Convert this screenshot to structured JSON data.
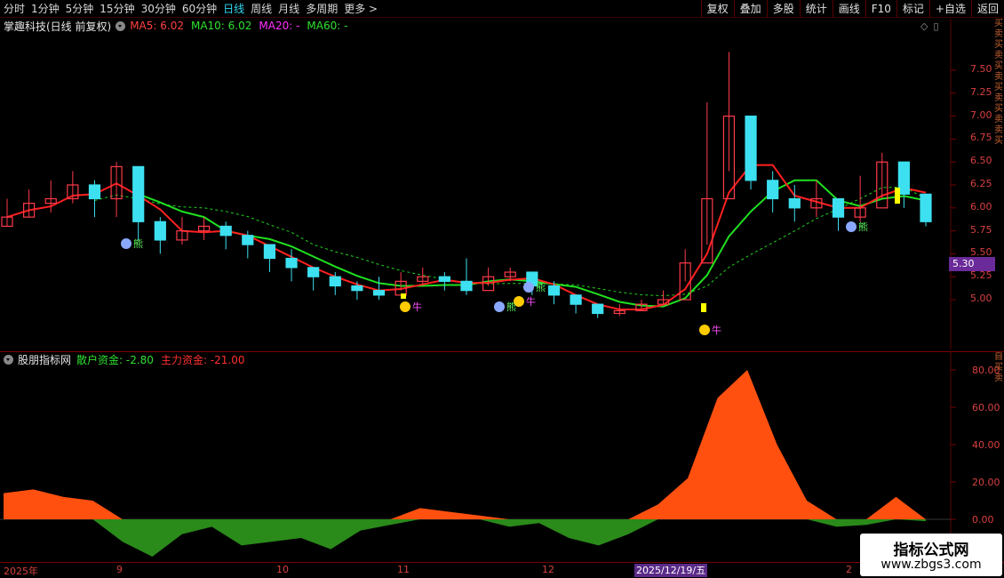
{
  "toolbar": {
    "left_tabs": [
      "分时",
      "1分钟",
      "5分钟",
      "15分钟",
      "30分钟",
      "60分钟",
      "日线",
      "周线",
      "月线",
      "多周期",
      "更多"
    ],
    "active_tab": "日线",
    "more_arrow": ">",
    "right_buttons": [
      "复权",
      "叠加",
      "多股",
      "统计",
      "画线",
      "F10",
      "标记",
      "+自选",
      "返回"
    ]
  },
  "price_panel": {
    "stock_name": "掌趣科技(日线 前复权)",
    "ma_labels": [
      {
        "text": "MA5: 6.02",
        "color": "#ff4040"
      },
      {
        "text": "MA10: 6.02",
        "color": "#30e030"
      },
      {
        "text": "MA20: -",
        "color": "#ff30ff"
      },
      {
        "text": "MA60: -",
        "color": "#30e030"
      }
    ],
    "y_ticks": [
      "7.50",
      "7.25",
      "7.00",
      "6.75",
      "6.50",
      "6.25",
      "6.00",
      "5.75",
      "5.50",
      "5.25",
      "5.00"
    ],
    "current_price_label": "5.30",
    "annotations": [
      "熊",
      "熊",
      "熊",
      "牛",
      "牛",
      "牛",
      "熊"
    ],
    "side_text": "买卖买卖买卖买卖买卖卖买"
  },
  "indicator_panel": {
    "name": "股朋指标网",
    "retail_label": "散户资金: -2.80",
    "main_label": "主力资金: -21.00",
    "y_ticks": [
      "80.00",
      "60.00",
      "40.00",
      "20.00",
      "0.00"
    ],
    "side_text": "自买卖"
  },
  "date_axis": {
    "labels": [
      "2025年",
      "9",
      "10",
      "11",
      "12",
      "2"
    ],
    "cursor_date": "2025/12/19/五"
  },
  "watermark": {
    "title": "指标公式网",
    "url": "www.zbgs3.com"
  },
  "colors": {
    "up": "#ff3a4a",
    "down": "#3de0f0",
    "ma5": "#ff2020",
    "ma10": "#20e020",
    "ma60": "#20d020",
    "main_fund": "#ff5010",
    "retail_fund": "#2a8a1a",
    "axis": "#d84040"
  },
  "chart_data": [
    {
      "type": "candlestick",
      "series": [
        {
          "name": "MA5"
        },
        {
          "name": "MA10"
        },
        {
          "name": "MA20"
        },
        {
          "name": "MA60"
        }
      ],
      "ylim": [
        4.7,
        7.8
      ],
      "x": [
        "2025年",
        "9",
        "10",
        "11",
        "12",
        "2025/12/19/五",
        "2"
      ],
      "close": [
        5.9,
        6.05,
        6.1,
        6.25,
        6.1,
        6.45,
        5.85,
        5.65,
        5.75,
        5.8,
        5.7,
        5.6,
        5.45,
        5.35,
        5.25,
        5.15,
        5.1,
        5.05,
        5.2,
        5.25,
        5.2,
        5.1,
        5.25,
        5.3,
        5.15,
        5.05,
        4.95,
        4.85,
        4.88,
        4.95,
        5.0,
        5.4,
        6.1,
        7.0,
        6.3,
        6.1,
        6.0,
        6.1,
        5.9,
        6.0,
        6.5,
        6.15,
        5.85
      ],
      "high": [
        6.1,
        6.2,
        6.3,
        6.4,
        6.3,
        6.5,
        6.1,
        5.9,
        5.9,
        5.9,
        5.85,
        5.75,
        5.6,
        5.55,
        5.35,
        5.3,
        5.2,
        5.25,
        5.3,
        5.35,
        5.3,
        5.45,
        5.35,
        5.35,
        5.3,
        5.2,
        5.05,
        4.95,
        4.95,
        5.0,
        5.1,
        5.55,
        7.15,
        7.7,
        6.85,
        6.4,
        6.25,
        6.3,
        6.1,
        6.35,
        6.6,
        6.3,
        6.0
      ],
      "low": [
        5.8,
        5.9,
        5.95,
        6.05,
        5.9,
        5.9,
        5.65,
        5.5,
        5.6,
        5.65,
        5.55,
        5.45,
        5.3,
        5.2,
        5.1,
        5.05,
        5.0,
        5.0,
        5.1,
        5.15,
        5.1,
        5.05,
        5.15,
        5.2,
        5.05,
        4.95,
        4.85,
        4.8,
        4.82,
        4.9,
        4.95,
        5.2,
        5.6,
        6.4,
        6.2,
        5.95,
        5.85,
        5.9,
        5.75,
        5.85,
        6.1,
        6.0,
        5.8
      ]
    },
    {
      "type": "area",
      "series": [
        {
          "name": "散户资金"
        },
        {
          "name": "主力资金"
        }
      ],
      "ylim": [
        -21,
        84
      ],
      "x": [
        "2025年",
        "9",
        "10",
        "11",
        "12",
        "2025/12/19/五",
        "2"
      ],
      "values": [
        14,
        16,
        12,
        10,
        -12,
        -20,
        -8,
        -4,
        -14,
        -12,
        -10,
        -16,
        -6,
        -3,
        6,
        4,
        2,
        -4,
        -2,
        -10,
        -14,
        -8,
        8,
        22,
        65,
        80,
        40,
        10,
        -4,
        -3,
        12,
        -1
      ]
    }
  ]
}
